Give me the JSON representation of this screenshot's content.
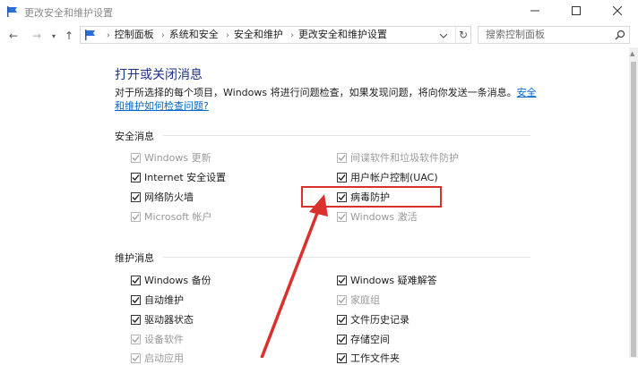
{
  "window": {
    "title": "更改安全和维护设置",
    "controls": [
      "minimize",
      "maximize",
      "close"
    ]
  },
  "nav": {
    "breadcrumbs": [
      "控制面板",
      "系统和安全",
      "安全和维护",
      "更改安全和维护设置"
    ],
    "search_placeholder": "搜索控制面板"
  },
  "page": {
    "title": "打开或关闭消息",
    "description": "对于所选择的每个项目，Windows 将进行问题检查，如果发现问题，将向你发送一条消息。",
    "link": "安全和维护如何检查问题?"
  },
  "security": {
    "heading": "安全消息",
    "items": [
      {
        "label": "Windows 更新",
        "checked": true,
        "enabled": false
      },
      {
        "label": "间谍软件和垃圾软件防护",
        "checked": true,
        "enabled": false
      },
      {
        "label": "Internet 安全设置",
        "checked": true,
        "enabled": true
      },
      {
        "label": "用户帐户控制(UAC)",
        "checked": true,
        "enabled": true
      },
      {
        "label": "网络防火墙",
        "checked": true,
        "enabled": true
      },
      {
        "label": "病毒防护",
        "checked": true,
        "enabled": true
      },
      {
        "label": "Microsoft 帐户",
        "checked": true,
        "enabled": false
      },
      {
        "label": "Windows 激活",
        "checked": true,
        "enabled": false
      }
    ]
  },
  "maintenance": {
    "heading": "维护消息",
    "items": [
      {
        "label": "Windows 备份",
        "checked": true,
        "enabled": true
      },
      {
        "label": "Windows 疑难解答",
        "checked": true,
        "enabled": true
      },
      {
        "label": "自动维护",
        "checked": true,
        "enabled": true
      },
      {
        "label": "家庭组",
        "checked": true,
        "enabled": false
      },
      {
        "label": "驱动器状态",
        "checked": true,
        "enabled": true
      },
      {
        "label": "文件历史记录",
        "checked": true,
        "enabled": true
      },
      {
        "label": "设备软件",
        "checked": true,
        "enabled": false
      },
      {
        "label": "存储空间",
        "checked": true,
        "enabled": true
      },
      {
        "label": "启动应用",
        "checked": true,
        "enabled": false
      },
      {
        "label": "工作文件夹",
        "checked": true,
        "enabled": true
      }
    ]
  },
  "colors": {
    "title_blue": "#1e3287",
    "link_blue": "#0066cc",
    "annotation_red": "#d9312c"
  }
}
